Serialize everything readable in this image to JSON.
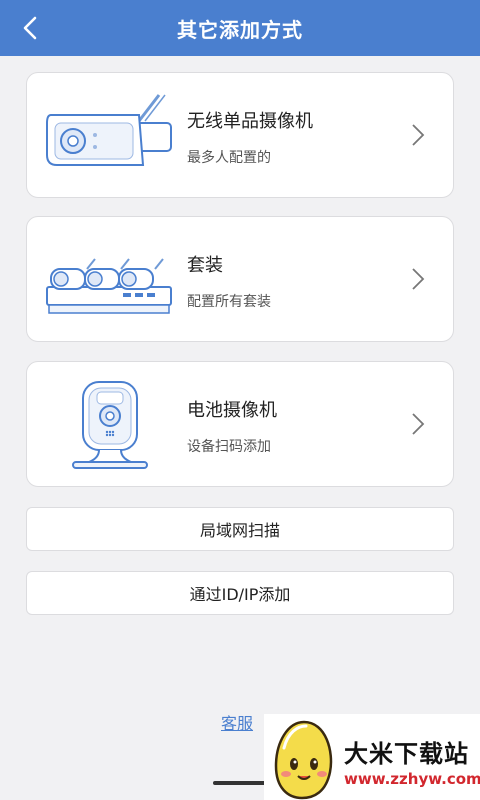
{
  "header": {
    "title": "其它添加方式"
  },
  "cards": [
    {
      "title": "无线单品摄像机",
      "subtitle": "最多人配置的"
    },
    {
      "title": "套装",
      "subtitle": "配置所有套装"
    },
    {
      "title": "电池摄像机",
      "subtitle": "设备扫码添加"
    }
  ],
  "buttons": {
    "lan_scan": "局域网扫描",
    "add_by_id_ip": "通过ID/IP添加"
  },
  "footer": {
    "service_link": "客服"
  },
  "watermark": {
    "title": "大米下载站",
    "url": "www.zzhyw.com"
  },
  "colors": {
    "primary": "#4a7fcf",
    "background": "#f1f1f3",
    "watermark_red": "#d2272e"
  },
  "icons": [
    "back-arrow-icon",
    "chevron-right-icon",
    "wireless-camera-icon",
    "camera-kit-icon",
    "battery-camera-icon"
  ]
}
